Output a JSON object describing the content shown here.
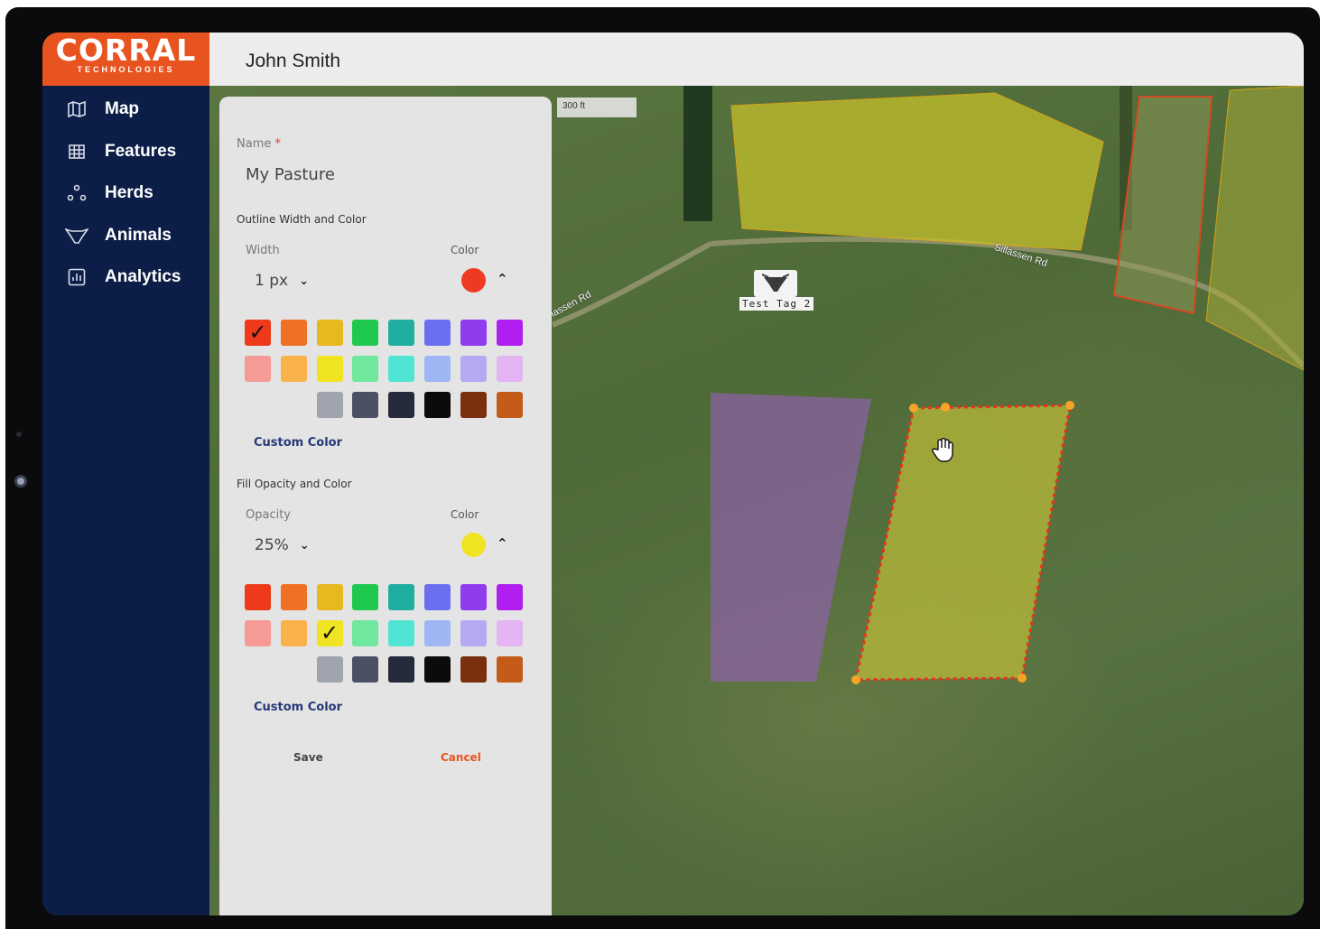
{
  "app": {
    "logo_text": "CORRAL",
    "logo_sub": "TECHNOLOGIES",
    "user_name": "John Smith"
  },
  "sidebar": {
    "items": [
      {
        "label": "Map",
        "icon": "map-icon"
      },
      {
        "label": "Features",
        "icon": "grid-icon"
      },
      {
        "label": "Herds",
        "icon": "herd-icon"
      },
      {
        "label": "Animals",
        "icon": "cow-icon"
      },
      {
        "label": "Analytics",
        "icon": "analytics-icon"
      }
    ]
  },
  "map": {
    "scale_label": "300 ft",
    "road_label_1": "Sillassen Rd",
    "road_label_2": "lassen Rd",
    "tag_label": "Test Tag 2",
    "pasture_colors": {
      "top_pasture": "#c3c02c",
      "purple_pasture": "#8e61a8",
      "selected_pasture_fill": "#b8b83a",
      "selected_pasture_outline": "#e8321d",
      "right_pasture_outline": "#d24a22"
    }
  },
  "panel": {
    "name_label": "Name",
    "name_required_mark": "*",
    "name_value": "My Pasture",
    "outline_section": "Outline Width and Color",
    "width_label": "Width",
    "width_value": "1 px",
    "outline_color_label": "Color",
    "outline_color": "#ee3a20",
    "fill_section": "Fill Opacity and Color",
    "opacity_label": "Opacity",
    "opacity_value": "25%",
    "fill_color_label": "Color",
    "fill_color": "#f0e321",
    "custom_color_label": "Custom Color",
    "save_label": "Save",
    "cancel_label": "Cancel",
    "check_mark": "✓",
    "swatch_rows": [
      [
        "#ee3a1a",
        "#f07024",
        "#e7b820",
        "#1fc84e",
        "#1faea0",
        "#6c6ef0",
        "#8f3cef",
        "#b01ff0"
      ],
      [
        "#f59a94",
        "#f9b24a",
        "#f0e321",
        "#6fe79c",
        "#4fe4d4",
        "#9fb6f5",
        "#b5a9f2",
        "#e4b4f4"
      ],
      [
        null,
        null,
        "#9fa4ae",
        "#4b5065",
        "#252a3c",
        "#0a0a0a",
        "#7a300e",
        "#c45b18"
      ]
    ],
    "outline_selected": [
      0,
      0
    ],
    "fill_selected": [
      1,
      2
    ]
  }
}
